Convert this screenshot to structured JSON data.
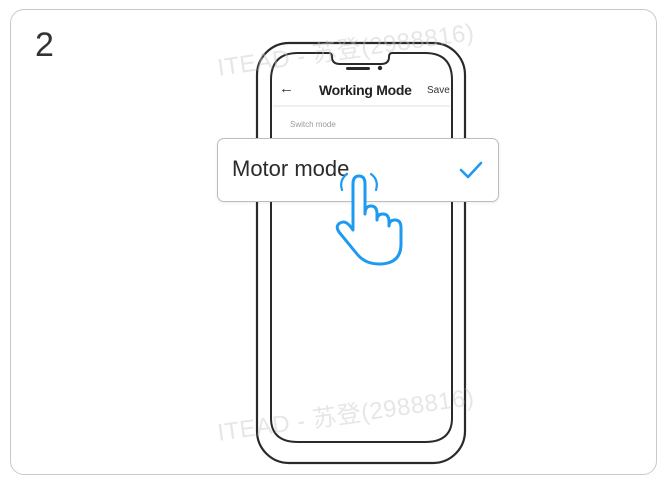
{
  "step": {
    "number": "2"
  },
  "phone": {
    "back_icon": "arrow-left-icon",
    "title": "Working Mode",
    "save_label": "Save",
    "section_label": "Switch mode"
  },
  "selected_option": {
    "label": "Motor mode",
    "check_icon": "checkmark-icon",
    "check_color": "#1e9bf0"
  },
  "pointer": {
    "icon": "hand-pointer-icon"
  },
  "watermark": {
    "text": "ITEAD - 苏登(2988816)"
  }
}
